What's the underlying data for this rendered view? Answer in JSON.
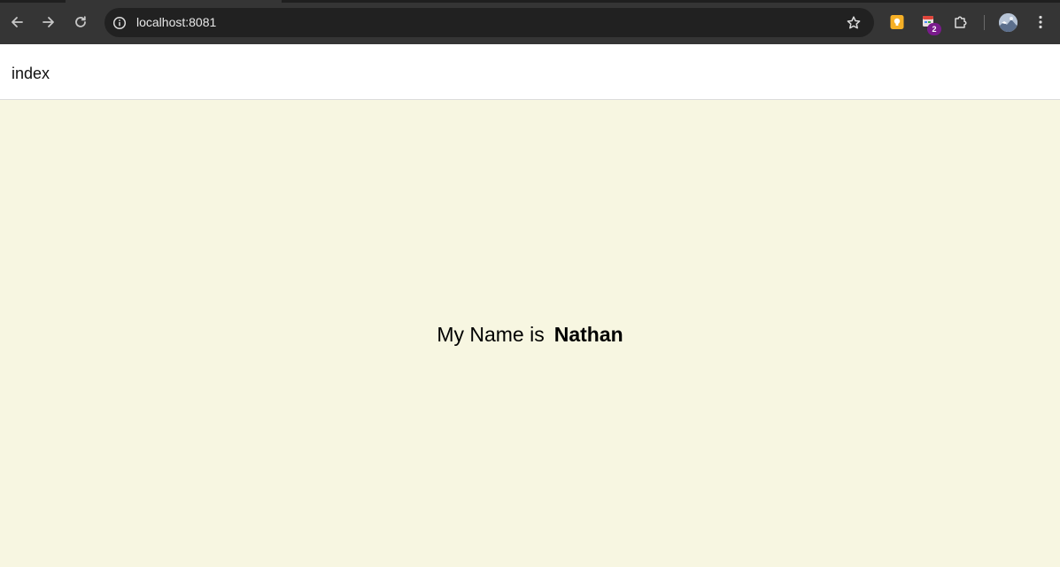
{
  "browser": {
    "url": "localhost:8081",
    "extension_badge": "2",
    "colors": {
      "toolbar": "#353535",
      "omnibox": "#212121",
      "badge": "#7a1b8c"
    }
  },
  "header": {
    "title": "index"
  },
  "main": {
    "prefix": "My Name is",
    "name": "Nathan",
    "background": "#f7f6e1"
  },
  "icons": {
    "back": "back-arrow-icon",
    "forward": "forward-arrow-icon",
    "reload": "reload-icon",
    "site_info": "info-icon",
    "bookmark": "star-icon",
    "extension_1": "keep-notes-icon",
    "extension_2": "calendar-extension-icon",
    "extensions": "puzzle-icon",
    "profile": "avatar",
    "menu": "kebab-menu-icon"
  }
}
